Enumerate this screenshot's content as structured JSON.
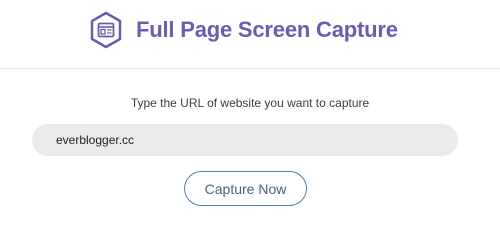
{
  "header": {
    "title": "Full Page Screen Capture",
    "logo_icon": "browser-window-icon",
    "accent_color": "#6a5cb1"
  },
  "main": {
    "prompt": "Type the URL of website you want to capture",
    "url_input": {
      "value": "everblogger.cc"
    },
    "capture_button_label": "Capture Now",
    "button_color": "#4f7fa8"
  }
}
